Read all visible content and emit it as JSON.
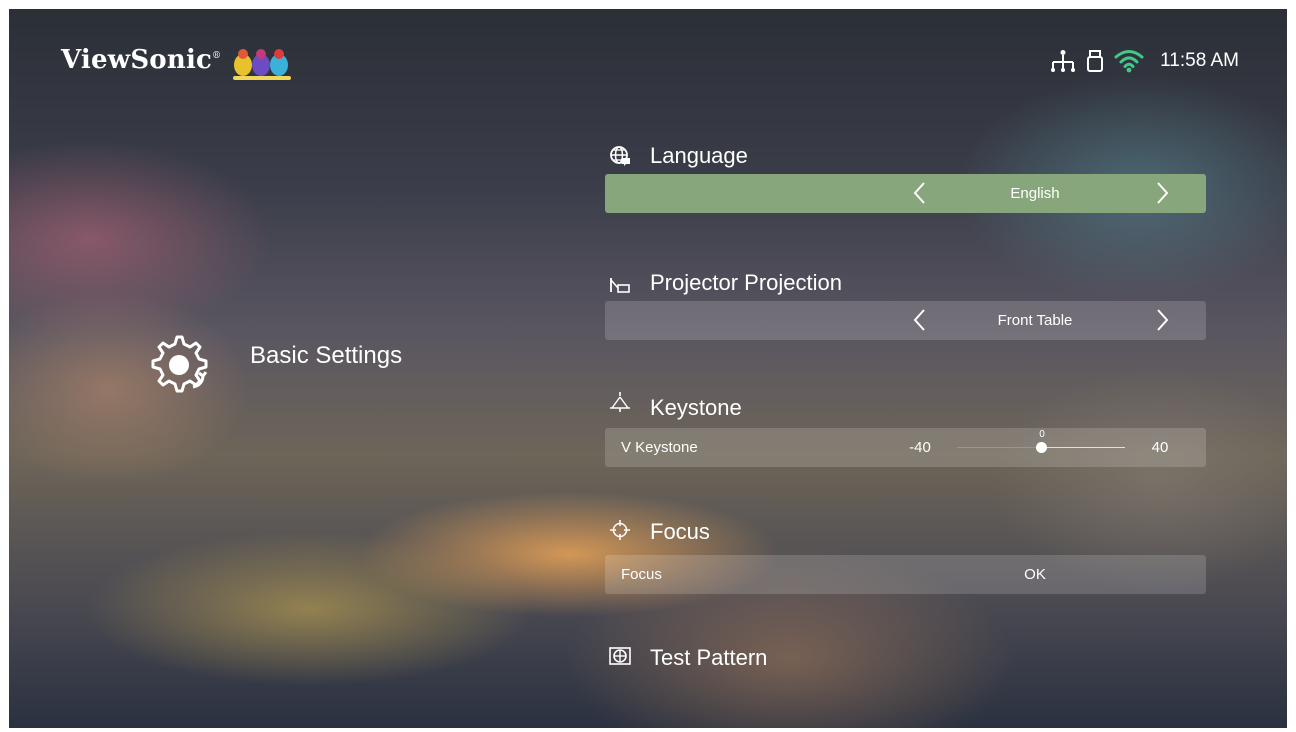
{
  "brand": {
    "name": "ViewSonic",
    "mark": "®"
  },
  "status": {
    "time": "11:58 AM",
    "icons": [
      "network-icon",
      "usb-icon",
      "wifi-icon"
    ]
  },
  "page": {
    "title": "Basic Settings",
    "icon": "gear-settings-icon"
  },
  "settings": [
    {
      "label": "Language",
      "icon": "globe-icon",
      "value": "English",
      "selected": true
    },
    {
      "label": "Projector Projection",
      "icon": "projector-icon",
      "value": "Front Table",
      "selected": false
    },
    {
      "label": "Keystone",
      "icon": "keystone-icon",
      "sub_label": "V Keystone",
      "min": "-40",
      "max": "40",
      "current": "0",
      "level": 0.5
    },
    {
      "label": "Focus",
      "icon": "focus-icon",
      "sub_label": "Focus",
      "value": "OK"
    },
    {
      "label": "Test Pattern",
      "icon": "test-pattern-icon"
    }
  ],
  "colors": {
    "selected_row": "#87a67b",
    "slider_track": "#5aa8d8",
    "text": "#ffffff"
  }
}
